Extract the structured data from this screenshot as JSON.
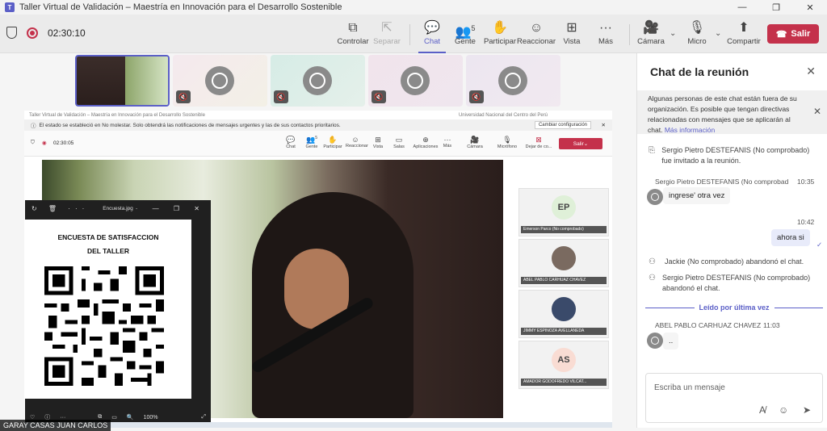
{
  "window": {
    "title": "Taller Virtual de Validación – Maestría en Innovación para el Desarrollo Sostenible"
  },
  "meeting": {
    "timer": "02:30:10"
  },
  "toolbar": {
    "controlar": "Controlar",
    "separar": "Separar",
    "chat": "Chat",
    "gente": "Gente",
    "gente_count": "5",
    "participar": "Participar",
    "reaccionar": "Reaccionar",
    "vista": "Vista",
    "mas": "Más",
    "camara": "Cámara",
    "micro": "Micro",
    "compartir": "Compartir",
    "salir": "Salir"
  },
  "shared_screen": {
    "mini_title": "Taller Virtual de Validación – Maestría en Innovación para el Desarrollo Sostenible",
    "mini_title_right": "Universidad Nacional del Centro del Perú",
    "dnd_notice": "El estado se estableció en No molestar. Solo obtendrá las notificaciones de mensajes urgentes y las de sus contactos prioritarios.",
    "dnd_button": "Cambiar configuración",
    "mini_timer": "02:30:05",
    "mini_buttons": [
      "Chat",
      "Gente",
      "Participar",
      "Reaccionar",
      "Vista",
      "Salas",
      "Aplicaciones",
      "Más",
      "Cámara",
      "Micrófono",
      "Dejar de co..."
    ],
    "mini_gente_count": "5",
    "mini_leave": "Salir",
    "viewer_filename": "Encuesta.jpg",
    "doc_heading_1": "ENCUESTA DE SATISFACCION",
    "doc_heading_2": "DEL TALLER",
    "zoom": "100%",
    "presenter_name": "GARAY CASAS JUAN CARLOS",
    "participants": [
      {
        "initials": "EP",
        "name": "Emerson Parco (No comprobado)",
        "color": "#dff0d8"
      },
      {
        "initials": "",
        "name": "ABEL PABLO CARHUAZ CHAVEZ",
        "color": "#f2f2f2"
      },
      {
        "initials": "",
        "name": "JIMMY ESPINOZA AVELLANEDA",
        "color": "#f2f2f2"
      },
      {
        "initials": "AS",
        "name": "AMADOR GODOFREDO VILCAT...",
        "color": "#f9dcd3"
      }
    ]
  },
  "chat": {
    "header": "Chat de la reunión",
    "notice_text": "Algunas personas de este chat están fuera de su organización. Es posible que tengan directivas relacionadas con mensajes que se aplicarán al chat.",
    "notice_link": "Más información",
    "sys_invited": "Sergio Pietro DESTEFANIS (No comprobado) fue invitado a la reunión.",
    "msg1_sender": "Sergio Pietro DESTEFANIS (No comprobad",
    "msg1_time": "10:35",
    "msg1_text": "ingrese' otra vez",
    "my_time": "10:42",
    "my_text": "ahora si",
    "sys_left_1": "Jackie (No comprobado) abandonó el chat.",
    "sys_left_2": "Sergio Pietro DESTEFANIS (No comprobado) abandonó el chat.",
    "last_read": "Leído por última vez",
    "msg2_sender": "ABEL PABLO CARHUAZ CHAVEZ",
    "msg2_time": "11:03",
    "msg2_text": "..",
    "compose_placeholder": "Escriba un mensaje"
  }
}
